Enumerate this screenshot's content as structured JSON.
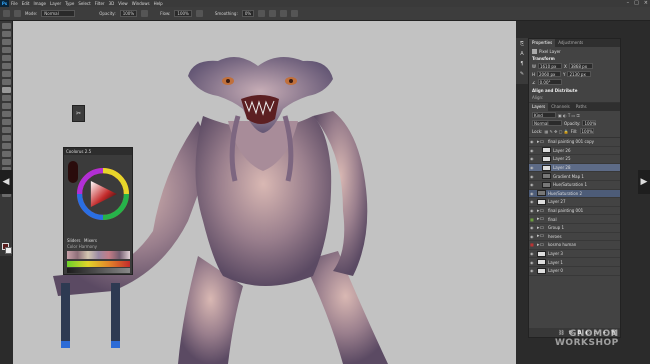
{
  "menu": {
    "logo": "Ps",
    "items": [
      "File",
      "Edit",
      "Image",
      "Layer",
      "Type",
      "Select",
      "Filter",
      "3D",
      "View",
      "Windows",
      "Help"
    ]
  },
  "options": {
    "mode_label": "Mode:",
    "mode_value": "Normal",
    "opacity_label": "Opacity:",
    "opacity_value": "100%",
    "flow_label": "Flow:",
    "flow_value": "100%",
    "smoothing_label": "Smoothing:",
    "smoothing_value": "0%"
  },
  "colorwheel": {
    "title": "Coolorus 2.5",
    "tabs": [
      "Sliders",
      "Mixers"
    ],
    "mixer_label": "Color Harmony"
  },
  "properties": {
    "tabs": [
      "Properties",
      "Adjustments"
    ],
    "layer_type": "Pixel Layer",
    "transform_header": "Transform",
    "w": "1610 px",
    "h": "2060 px",
    "x": "3868 px",
    "y": "2130 px",
    "angle": "0.00°",
    "align_header": "Align and Distribute",
    "align_sub": "Align:"
  },
  "layers": {
    "tabs": [
      "Layers",
      "Channels",
      "Paths"
    ],
    "kind": "Kind",
    "blend": "Normal",
    "opacity_label": "Opacity:",
    "opacity": "100%",
    "fill_label": "Fill:",
    "fill": "100%",
    "lock_label": "Lock:",
    "items": [
      {
        "name": "final painting 001 copy",
        "type": "folder"
      },
      {
        "name": "Layer 26",
        "type": "layer"
      },
      {
        "name": "Layer 25",
        "type": "layer"
      },
      {
        "name": "Layer 28",
        "type": "layer"
      },
      {
        "name": "Gradient Map 1",
        "type": "adj"
      },
      {
        "name": "Hue/Saturation 1",
        "type": "adj"
      },
      {
        "name": "Hue/Saturation 2",
        "type": "adj"
      },
      {
        "name": "Layer 27",
        "type": "layer"
      },
      {
        "name": "final painting 001",
        "type": "folder"
      },
      {
        "name": "final",
        "type": "layer"
      },
      {
        "name": "Group 1",
        "type": "folder"
      },
      {
        "name": "heroes",
        "type": "layer"
      },
      {
        "name": "kosmo human",
        "type": "layer"
      },
      {
        "name": "Layer 3",
        "type": "layer"
      },
      {
        "name": "Layer 1",
        "type": "layer"
      },
      {
        "name": "Layer 0",
        "type": "layer"
      }
    ]
  },
  "watermark": {
    "line1": "GNOMON",
    "line2": "WORKSHOP"
  },
  "colors": {
    "panel": "#434343",
    "canvas": "#c2c2c2",
    "accent": "#5d6b87"
  }
}
